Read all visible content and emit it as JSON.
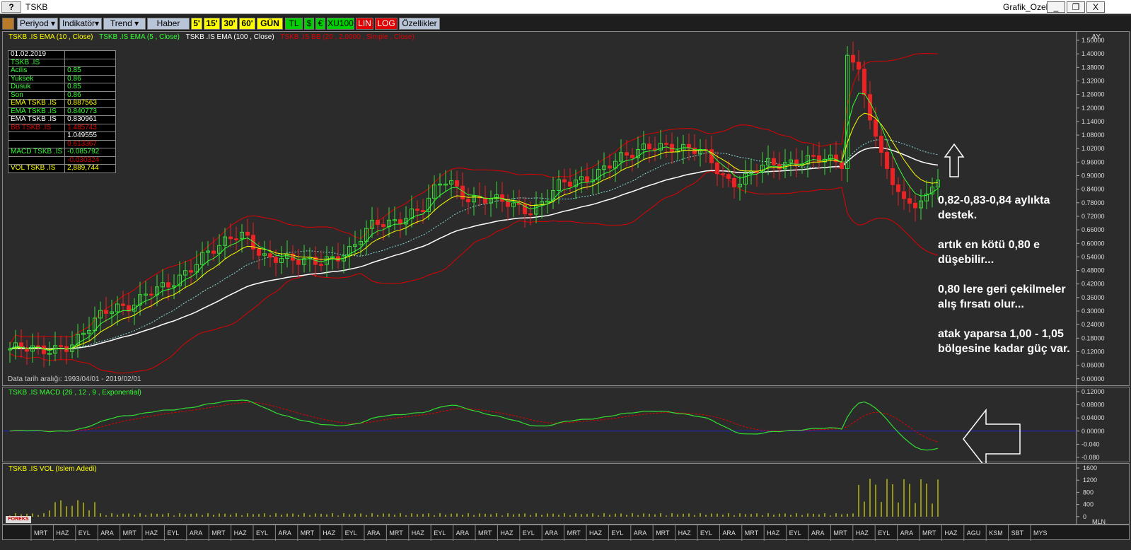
{
  "window": {
    "symbol_tab": "TSKB",
    "help_btn": "?",
    "name": "Grafik_Ozel",
    "min": "_",
    "restore": "❐",
    "close": "X"
  },
  "toolbar": {
    "periyod": "Periyod",
    "indikator": "Indikatör",
    "trend": "Trend",
    "haber": "Haber",
    "p5": "5'",
    "p15": "15'",
    "p30": "30'",
    "p60": "60'",
    "gun": "GÜN",
    "tl": "TL",
    "usd": "$",
    "eur": "€",
    "xu100": "XU100",
    "lin": "LIN",
    "log": "LOG",
    "ozellikler": "Özellikler"
  },
  "main": {
    "legend": [
      {
        "text": "TSKB .IS EMA (10 , Close)",
        "color": "#ffff00"
      },
      {
        "text": "TSKB .IS EMA (5 , Close)",
        "color": "#33ff33"
      },
      {
        "text": "TSKB .IS EMA (100 , Close)",
        "color": "#ffffff"
      },
      {
        "text": "TSKB .IS BB (20 , 2.0000 , Simple , Close)",
        "color": "#e00000"
      }
    ],
    "period_label": "AY",
    "date_range": "Data tarih aralığı: 1993/04/01 - 2019/02/01",
    "yticks": [
      "1.50000",
      "1.40000",
      "1.38000",
      "1.32000",
      "1.26000",
      "1.20000",
      "1.14000",
      "1.08000",
      "1.02000",
      "0.96000",
      "0.90000",
      "0.84000",
      "0.78000",
      "0.72000",
      "0.66000",
      "0.60000",
      "0.54000",
      "0.48000",
      "0.42000",
      "0.36000",
      "0.30000",
      "0.24000",
      "0.18000",
      "0.12000",
      "0.06000",
      "0.00000"
    ]
  },
  "info": {
    "rows": [
      {
        "k": "01.02.2019",
        "v": "",
        "kc": "#ffffff",
        "vc": "#ffffff"
      },
      {
        "k": "TSKB .IS",
        "v": "",
        "kc": "#33ff33",
        "vc": "#33ff33"
      },
      {
        "k": "  Acilis",
        "v": "0.85",
        "kc": "#33ff33",
        "vc": "#33ff33"
      },
      {
        "k": "  Yuksek",
        "v": "0.86",
        "kc": "#33ff33",
        "vc": "#33ff33"
      },
      {
        "k": "  Dusuk",
        "v": "0.85",
        "kc": "#33ff33",
        "vc": "#33ff33"
      },
      {
        "k": "  Son",
        "v": "0.86",
        "kc": "#33ff33",
        "vc": "#33ff33"
      },
      {
        "k": "EMA TSKB .IS",
        "v": "0.887563",
        "kc": "#ffff00",
        "vc": "#ffff00"
      },
      {
        "k": "EMA TSKB .IS",
        "v": "0.840773",
        "kc": "#33ff33",
        "vc": "#33ff33"
      },
      {
        "k": "EMA TSKB .IS",
        "v": "0.830961",
        "kc": "#ffffff",
        "vc": "#ffffff"
      },
      {
        "k": "BB TSKB .IS",
        "v": "1.485743",
        "kc": "#e00000",
        "vc": "#e00000"
      },
      {
        "k": "",
        "v": "1.049555",
        "kc": "#ffffff",
        "vc": "#ffffff"
      },
      {
        "k": "",
        "v": "0.613367",
        "kc": "#e00000",
        "vc": "#e00000"
      },
      {
        "k": "MACD TSKB .IS",
        "v": "-0.085792",
        "kc": "#33ff33",
        "vc": "#33ff33"
      },
      {
        "k": "",
        "v": "-0.030324",
        "kc": "#e00000",
        "vc": "#e00000"
      },
      {
        "k": "VOL TSKB .IS",
        "v": "2,889,744",
        "kc": "#ffff00",
        "vc": "#ffff00"
      }
    ]
  },
  "annotations": {
    "a1": "0,82-0,83-0,84 aylıkta",
    "a2": "destek.",
    "a3": "artık en kötü 0,80 e",
    "a4": "düşebilir...",
    "a5": "0,80 lere geri çekilmeler",
    "a6": "alış fırsatı olur...",
    "a7": "atak yaparsa 1,00 - 1,05",
    "a8": "bölgesine kadar güç var."
  },
  "macd": {
    "legend": "TSKB .IS MACD (26 , 12 , 9 , Exponential)",
    "yticks": [
      "0.12000",
      "0.08000",
      "0.04000",
      "0.00000",
      "-0.040",
      "-0.080"
    ]
  },
  "vol": {
    "legend": "TSKB .IS VOL (Islem Adedi)",
    "yticks": [
      "1600",
      "1200",
      "800",
      "400",
      "0"
    ],
    "unit": "MLN",
    "logo": "FOREKS"
  },
  "xaxis": {
    "labels": [
      "MRT",
      "HAZ",
      "EYL",
      "ARA",
      "MRT",
      "HAZ",
      "EYL",
      "ARA",
      "MRT",
      "HAZ",
      "EYL",
      "ARA",
      "MRT",
      "HAZ",
      "EYL",
      "ARA",
      "MRT",
      "HAZ",
      "EYL",
      "ARA",
      "MRT",
      "HAZ",
      "EYL",
      "ARA",
      "MRT",
      "HAZ",
      "EYL",
      "ARA",
      "MRT",
      "HAZ",
      "EYL",
      "ARA",
      "MRT",
      "HAZ",
      "EYL",
      "ARA",
      "MRT",
      "HAZ",
      "EYL",
      "ARA",
      "MRT",
      "HAZ",
      "AGU",
      "KSM",
      "SBT",
      "MYS"
    ]
  },
  "colors": {
    "up": "#33dd33",
    "down": "#ee2222",
    "ema10": "#ffff00",
    "ema5": "#33ff33",
    "ema100": "#ffffff",
    "bb": "#e00000",
    "macd": "#33dd33",
    "signal": "#e00000",
    "zero": "#2222cc",
    "vol": "#ffff00"
  }
}
